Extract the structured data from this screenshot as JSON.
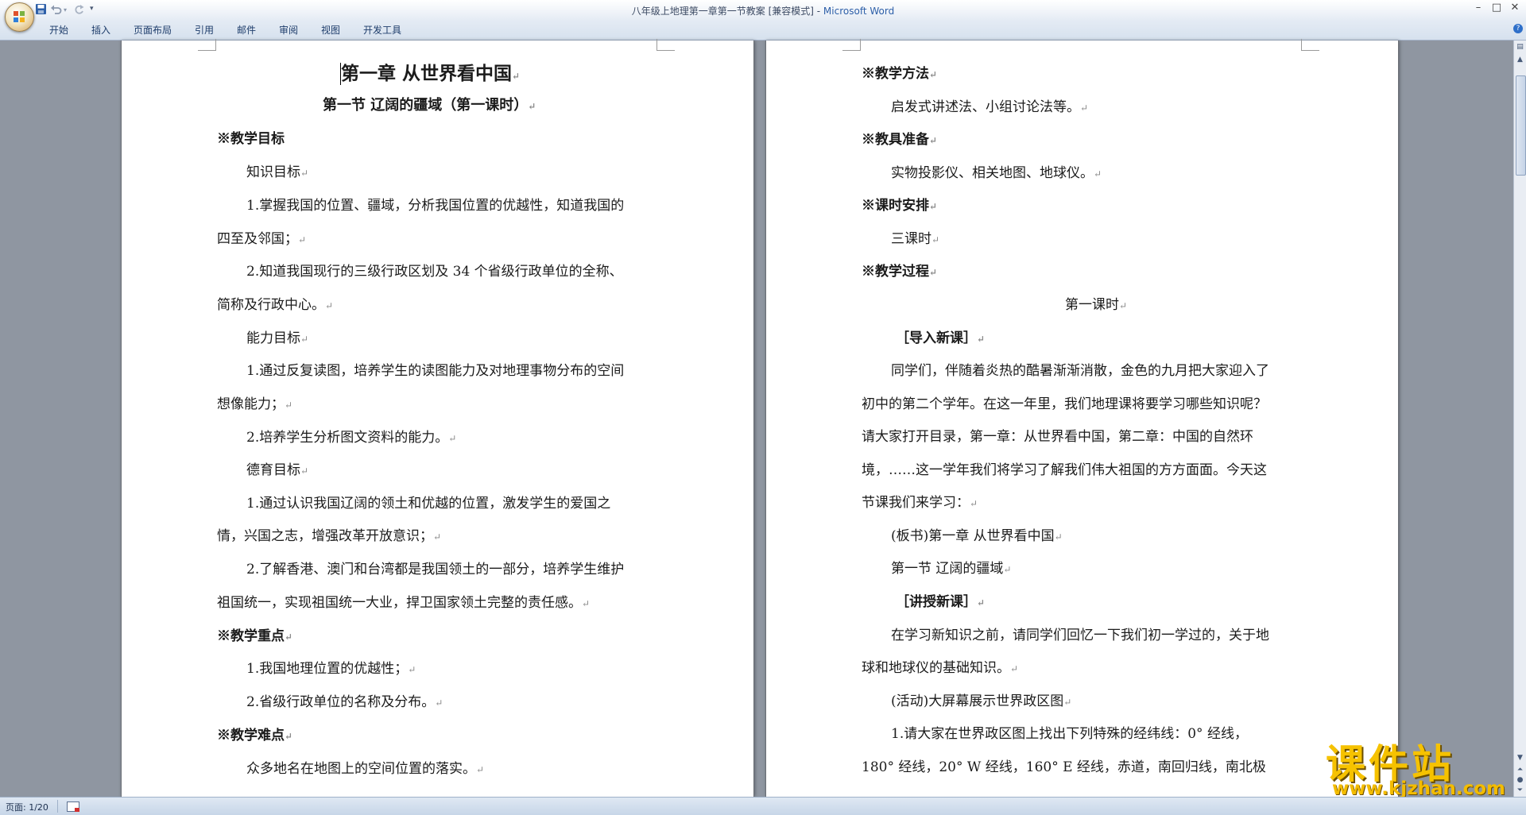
{
  "window": {
    "title": "八年级上地理第一章第一节教案 [兼容模式] - ",
    "app": "Microsoft Word",
    "minimize": "–",
    "maximize": "□",
    "close": "✕"
  },
  "ribbon": {
    "tabs": [
      "开始",
      "插入",
      "页面布局",
      "引用",
      "邮件",
      "审阅",
      "视图",
      "开发工具"
    ],
    "help": "?"
  },
  "qat": {
    "save_icon": "save-icon",
    "undo_icon": "undo-icon",
    "redo_icon": "redo-icon",
    "customize_icon": "▾"
  },
  "document": {
    "left_page": {
      "chapter_title": "第一章  从世界看中国",
      "section_title": "第一节  辽阔的疆域（第一课时）",
      "lines": [
        "※教学目标",
        "知识目标",
        "1.掌握我国的位置、疆域，分析我国位置的优越性，知道我国的",
        "四至及邻国；",
        "2.知道我国现行的三级行政区划及  34  个省级行政单位的全称、",
        "简称及行政中心。",
        "能力目标",
        "1.通过反复读图，培养学生的读图能力及对地理事物分布的空间",
        "想像能力；",
        "2.培养学生分析图文资料的能力。",
        "德育目标",
        "1.通过认识我国辽阔的领土和优越的位置，激发学生的爱国之",
        "情，兴国之志，增强改革开放意识；",
        "2.了解香港、澳门和台湾都是我国领土的一部分，培养学生维护",
        "祖国统一，实现祖国统一大业，捍卫国家领土完整的责任感。",
        "※教学重点",
        "1.我国地理位置的优越性；",
        "2.省级行政单位的名称及分布。",
        "※教学难点",
        "众多地名在地图上的空间位置的落实。"
      ]
    },
    "right_page": {
      "lines": [
        "※教学方法",
        "启发式讲述法、小组讨论法等。",
        "※教具准备",
        "实物投影仪、相关地图、地球仪。",
        "※课时安排",
        "三课时",
        "※教学过程",
        "第一课时",
        "［导入新课］",
        "同学们，伴随着炎热的酷暑渐渐消散，金色的九月把大家迎入了",
        "初中的第二个学年。在这一年里，我们地理课将要学习哪些知识呢？",
        "请大家打开目录，第一章：从世界看中国，第二章：中国的自然环",
        "境，……这一学年我们将学习了解我们伟大祖国的方方面面。今天这",
        "节课我们来学习：",
        "(板书)第一章    从世界看中国",
        "第一节    辽阔的疆域",
        "［讲授新课］",
        "在学习新知识之前，请同学们回忆一下我们初一学过的，关于地",
        "球和地球仪的基础知识。",
        "(活动)大屏幕展示世界政区图",
        "1.请大家在世界政区图上找出下列特殊的经纬线：0°  经线，",
        "180°  经线，20°  W 经线，160°  E 经线，赤道，南回归线，南北极"
      ]
    },
    "paragraph_mark": "↵"
  },
  "status": {
    "page_indicator": "页面: 1/20"
  },
  "watermark": {
    "text": "课件站",
    "url": "www.kjzhan.com"
  },
  "colors": {
    "workspace": "#8f96a1",
    "title_app": "#2d5fa8",
    "watermark": "#f6c200"
  }
}
